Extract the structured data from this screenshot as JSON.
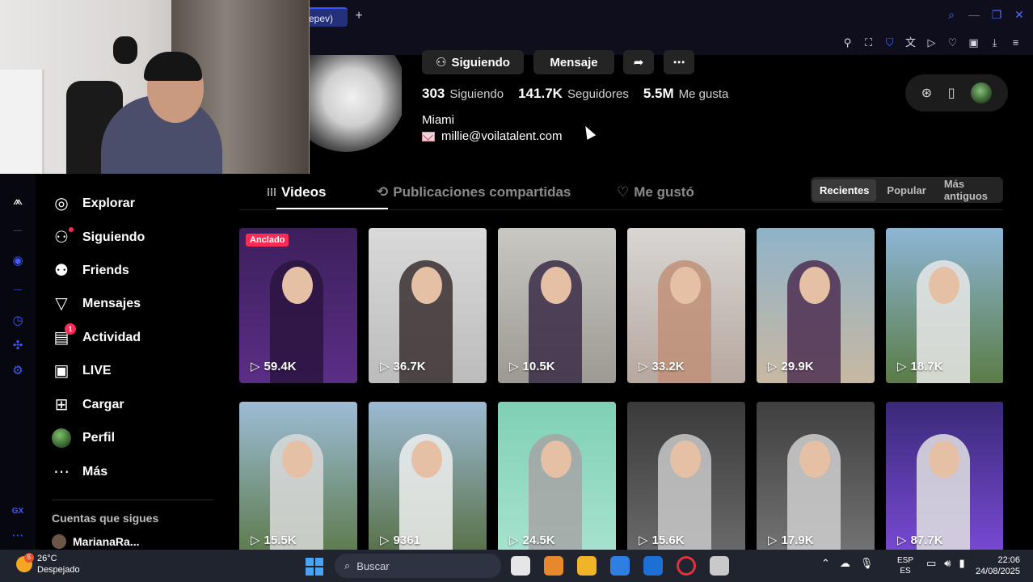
{
  "browser": {
    "tab_title": "epev)",
    "new_tab": "+",
    "window_controls": [
      {
        "icon": "search-icon",
        "glyph": "⌕"
      },
      {
        "icon": "minimize-icon",
        "glyph": "—"
      },
      {
        "icon": "restore-icon",
        "glyph": "❐"
      },
      {
        "icon": "close-icon",
        "glyph": "✕"
      }
    ],
    "toolbar_icons": [
      {
        "icon": "pin-icon",
        "glyph": "⚲"
      },
      {
        "icon": "snapshot-icon",
        "glyph": "⛶"
      },
      {
        "icon": "shield-icon",
        "glyph": "⛉"
      },
      {
        "icon": "translate-icon",
        "glyph": "文"
      },
      {
        "icon": "play-icon",
        "glyph": "▷"
      },
      {
        "icon": "heart-icon",
        "glyph": "♡"
      },
      {
        "icon": "wallet-icon",
        "glyph": "▣"
      },
      {
        "icon": "download-icon",
        "glyph": "⤓"
      },
      {
        "icon": "menu-icon",
        "glyph": "≡"
      }
    ]
  },
  "gx_sidebar": [
    {
      "icon": "gx-logo-icon",
      "glyph": "⩕"
    },
    {
      "icon": "player-icon",
      "glyph": "◉"
    },
    {
      "icon": "history-icon",
      "glyph": "◷"
    },
    {
      "icon": "extensions-icon",
      "glyph": "✣"
    },
    {
      "icon": "settings-icon",
      "glyph": "⚙"
    },
    {
      "icon": "gx-icon",
      "glyph": "GX"
    },
    {
      "icon": "more-icon",
      "glyph": "⋯"
    }
  ],
  "nav": {
    "items": [
      {
        "label": "Explorar",
        "icon": "compass-icon",
        "glyph": "◎"
      },
      {
        "label": "Siguiendo",
        "icon": "following-icon",
        "glyph": "⚇"
      },
      {
        "label": "Friends",
        "icon": "friends-icon",
        "glyph": "⚉"
      },
      {
        "label": "Mensajes",
        "icon": "messages-icon",
        "glyph": "▽"
      },
      {
        "label": "Actividad",
        "icon": "activity-icon",
        "glyph": "▤",
        "badge": "1"
      },
      {
        "label": "LIVE",
        "icon": "live-icon",
        "glyph": "▣"
      },
      {
        "label": "Cargar",
        "icon": "upload-icon",
        "glyph": "⊞"
      },
      {
        "label": "Perfil",
        "icon": "profile-avatar-icon"
      },
      {
        "label": "Más",
        "icon": "more-icon",
        "glyph": "⋯"
      }
    ],
    "following_title": "Cuentas que sigues",
    "following_first": "MarianaRa..."
  },
  "profile": {
    "btn_following": "Siguiendo",
    "btn_message": "Mensaje",
    "stats": [
      {
        "value": "303",
        "label": "Siguiendo"
      },
      {
        "value": "141.7K",
        "label": "Seguidores"
      },
      {
        "value": "5.5M",
        "label": "Me gusta"
      }
    ],
    "location": "Miami",
    "email": "millie@voilatalent.com"
  },
  "tabs": [
    {
      "label": "Videos",
      "icon": "grid-icon",
      "glyph": "⁞⁞⁞"
    },
    {
      "label": "Publicaciones compartidas",
      "icon": "repost-icon",
      "glyph": "⟲"
    },
    {
      "label": "Me gustó",
      "icon": "liked-icon",
      "glyph": "♡"
    }
  ],
  "sort": [
    "Recientes",
    "Popular",
    "Más antiguos"
  ],
  "pinned_label": "Anclado",
  "videos": [
    {
      "views": "59.4K",
      "bg": "#3d1f5c",
      "bg2": "#5b2e86",
      "figure": "#2a1440"
    },
    {
      "views": "36.7K",
      "bg": "#d9d9d9",
      "bg2": "#bcbcbc",
      "figure": "#3a3030"
    },
    {
      "views": "10.5K",
      "bg": "#c8c7c2",
      "bg2": "#9c9a92",
      "figure": "#3b2d48"
    },
    {
      "views": "33.2K",
      "bg": "#d8d6d3",
      "bg2": "#b7a8a0",
      "figure": "#c09078"
    },
    {
      "views": "29.9K",
      "bg": "#8fb3c9",
      "bg2": "#c8b8a2",
      "figure": "#4e2f52"
    },
    {
      "views": "18.7K",
      "bg": "#8db6d6",
      "bg2": "#5b7c47",
      "figure": "#e8e8e8"
    },
    {
      "views": "15.5K",
      "bg": "#9dbcd6",
      "bg2": "#5c7a4a",
      "figure": "#d9d9d9"
    },
    {
      "views": "9361",
      "bg": "#9cbad3",
      "bg2": "#566f45",
      "figure": "#efefef"
    },
    {
      "views": "24.5K",
      "bg": "#7fd0b4",
      "bg2": "#a8e3cf",
      "figure": "#a5a5a5"
    },
    {
      "views": "15.6K",
      "bg": "#3a3a3a",
      "bg2": "#6b6b6b",
      "figure": "#c9c9c9"
    },
    {
      "views": "17.9K",
      "bg": "#3f3f3f",
      "bg2": "#747474",
      "figure": "#cfcfcf"
    },
    {
      "views": "87.7K",
      "bg": "#3a2a78",
      "bg2": "#7a4ad6",
      "figure": "#e2e2e2"
    }
  ],
  "taskbar": {
    "weather_badge": "5",
    "temp": "26°C",
    "condition": "Despejado",
    "search": "Buscar",
    "lang_top": "ESP",
    "lang_bottom": "ES",
    "time": "22:06",
    "date": "24/08/2025",
    "app_colors": [
      "#e6e6e6",
      "#e8882c",
      "#f0b429",
      "#2f7fe0",
      "#1d6fd6",
      "#e0323c",
      "#c9c9c9"
    ]
  },
  "colors": {
    "accent": "#fe2c55",
    "gx_blue": "#3f5bff"
  }
}
